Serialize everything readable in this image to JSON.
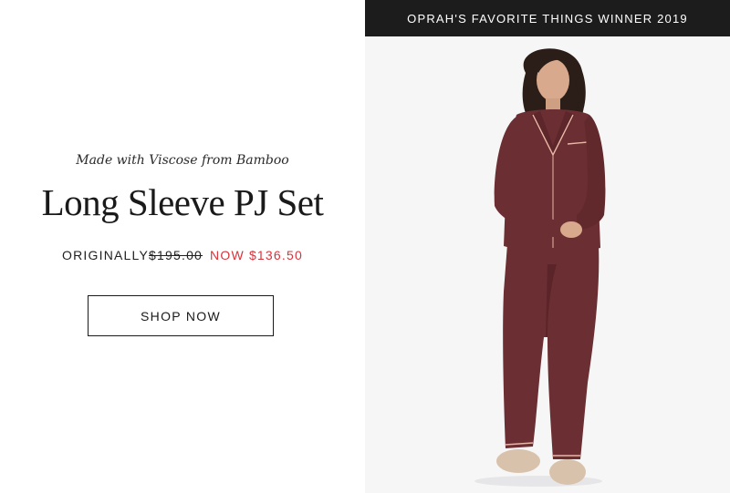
{
  "promo": {
    "eyebrow": "Made with Viscose from Bamboo",
    "title": "Long Sleeve PJ Set",
    "price": {
      "original_label": "ORIGINALLY",
      "original_value": "$195.00",
      "now_label": "NOW $136.50"
    },
    "cta_label": "SHOP NOW"
  },
  "image": {
    "banner": "OPRAH'S FAVORITE THINGS WINNER 2019",
    "subject": "model-wearing-burgundy-pajama-set"
  },
  "colors": {
    "sale_red": "#d6343c",
    "pajama_burgundy": "#6b2e32",
    "banner_bg": "#1c1c1c"
  }
}
